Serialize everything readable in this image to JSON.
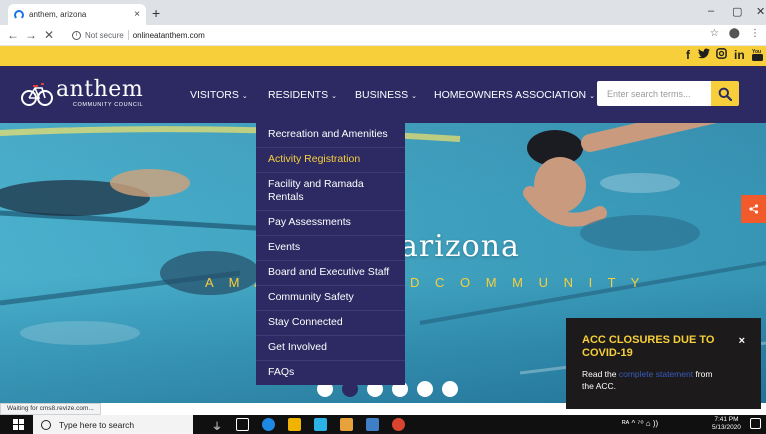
{
  "browser": {
    "tab_title": "anthem, arizona",
    "tab_close": "×",
    "new_tab": "+",
    "window_controls": [
      "–",
      "▢",
      "✕"
    ],
    "nav_back": "←",
    "nav_forward": "→",
    "nav_stop": "✕",
    "security_label": "Not secure",
    "url": "onlineatanthem.com",
    "star": "☆",
    "account": "⬤",
    "menu": "⋮"
  },
  "social": {
    "icons": [
      "facebook-icon",
      "twitter-icon",
      "instagram-icon",
      "linkedin-icon",
      "youtube-icon"
    ],
    "glyphs": [
      "f",
      "🐦",
      "◎",
      "in",
      "▶"
    ]
  },
  "header": {
    "logo_name": "anthem",
    "logo_sub": "COMMUNITY COUNCIL",
    "nav": [
      {
        "label": "VISITORS",
        "caret": "⌄"
      },
      {
        "label": "RESIDENTS",
        "caret": "⌄"
      },
      {
        "label": "BUSINESS",
        "caret": "⌄"
      },
      {
        "label": "HOMEOWNERS ASSOCIATION",
        "caret": "⌄"
      }
    ],
    "search_placeholder": "Enter search terms...",
    "colors": {
      "navy": "#2d2a63",
      "yellow": "#f7cf3b"
    }
  },
  "dropdown": {
    "items": [
      "Recreation and Amenities",
      "Activity Registration",
      "Facility and Ramada Rentals",
      "Pay Assessments",
      "Events",
      "Board and Executive Staff",
      "Community Safety",
      "Stay Connected",
      "Get Involved",
      "FAQs"
    ],
    "active_index": 1
  },
  "hero": {
    "title": "arizona",
    "tagline_left": "A M A",
    "tagline_right": "D   C O M M U N I T Y",
    "slides": 6,
    "active_slide": 1
  },
  "popup": {
    "title": "ACC CLOSURES DUE TO COVID-19",
    "close": "×",
    "body_prefix": "Read the",
    "link_text": "complete statement",
    "body_suffix": "from",
    "body_line2": "the ACC."
  },
  "status": {
    "text": "Waiting for cms8.revize.com..."
  },
  "taskbar": {
    "search_text": "Type here to search",
    "time": "7:41 PM",
    "date": "5/13/2020",
    "tray": "ᴿᴬ  ^  ⁷⁰  ⌂ ))"
  }
}
